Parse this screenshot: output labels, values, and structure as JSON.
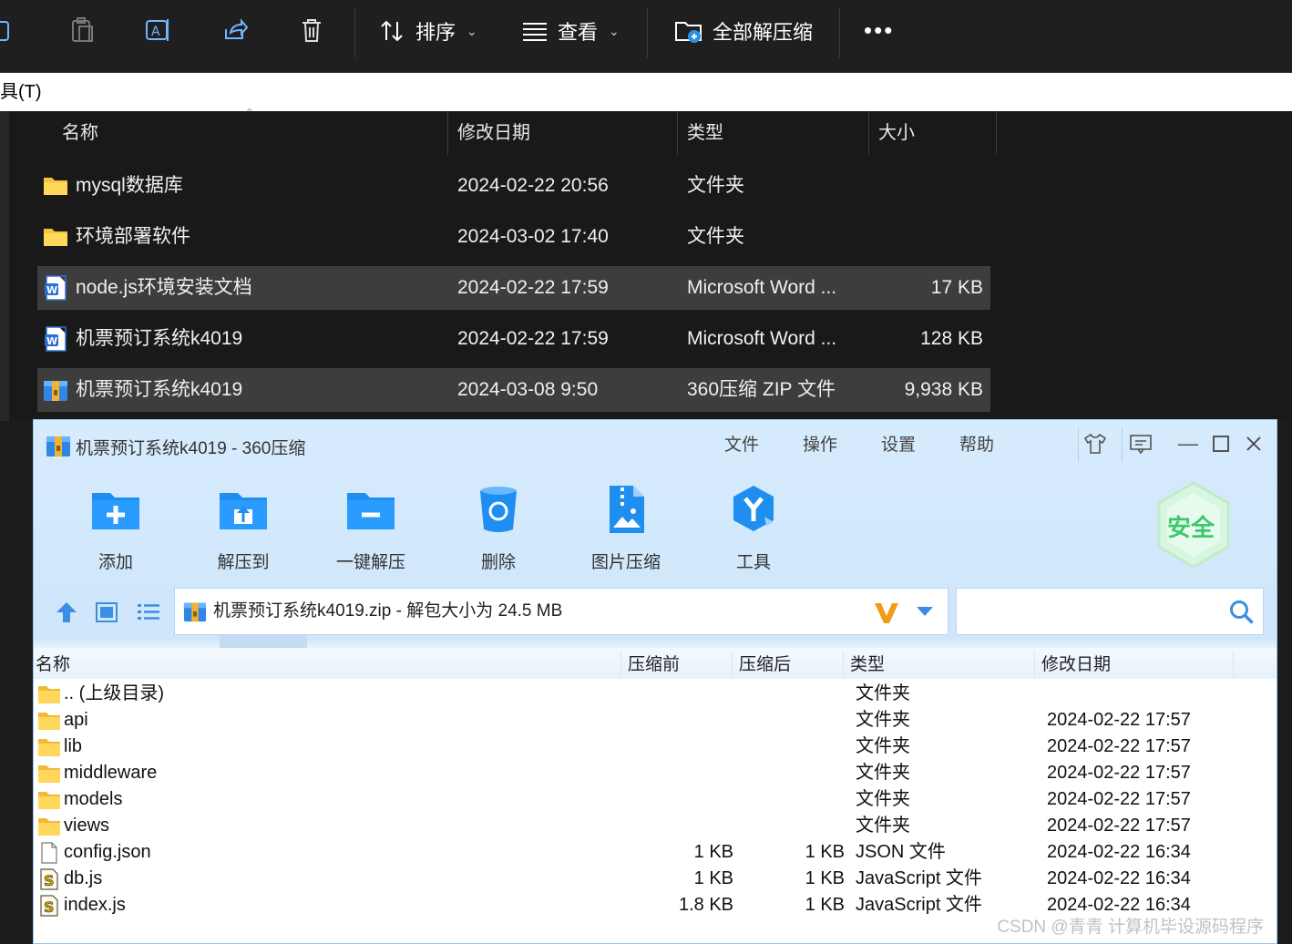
{
  "toolbar": {
    "sort_label": "排序",
    "view_label": "查看",
    "extract_all_label": "全部解压缩",
    "more_label": "•••"
  },
  "menu_strip": {
    "text": "具(T)"
  },
  "explorer": {
    "headers": {
      "name": "名称",
      "modified": "修改日期",
      "type": "类型",
      "size": "大小"
    },
    "rows": [
      {
        "name": "mysql数据库",
        "modified": "2024-02-22 20:56",
        "type": "文件夹",
        "size": "",
        "icon": "folder-icon",
        "selected": false
      },
      {
        "name": "环境部署软件",
        "modified": "2024-03-02 17:40",
        "type": "文件夹",
        "size": "",
        "icon": "folder-icon",
        "selected": false
      },
      {
        "name": "node.js环境安装文档",
        "modified": "2024-02-22 17:59",
        "type": "Microsoft Word ...",
        "size": "17 KB",
        "icon": "word-doc-icon",
        "selected": true
      },
      {
        "name": "机票预订系统k4019",
        "modified": "2024-02-22 17:59",
        "type": "Microsoft Word ...",
        "size": "128 KB",
        "icon": "word-doc-icon",
        "selected": false
      },
      {
        "name": "机票预订系统k4019",
        "modified": "2024-03-08 9:50",
        "type": "360压缩 ZIP 文件",
        "size": "9,938 KB",
        "icon": "zip-archive-icon",
        "selected": true
      }
    ]
  },
  "zip_window": {
    "title": "机票预订系统k4019 - 360压缩",
    "menu": {
      "file": "文件",
      "operate": "操作",
      "settings": "设置",
      "help": "帮助"
    },
    "tools": {
      "add": "添加",
      "extract_to": "解压到",
      "one_click": "一键解压",
      "delete": "删除",
      "image_compress": "图片压缩",
      "tools": "工具"
    },
    "safe_badge": "安全",
    "address": "机票预订系统k4019.zip - 解包大小为 24.5 MB",
    "search_placeholder": "",
    "headers": {
      "name": "名称",
      "before": "压缩前",
      "after": "压缩后",
      "type": "类型",
      "modified": "修改日期"
    },
    "rows": [
      {
        "name": ".. (上级目录)",
        "before": "",
        "after": "",
        "type": "文件夹",
        "modified": "",
        "icon": "folder-icon"
      },
      {
        "name": "api",
        "before": "",
        "after": "",
        "type": "文件夹",
        "modified": "2024-02-22 17:57",
        "icon": "folder-icon"
      },
      {
        "name": "lib",
        "before": "",
        "after": "",
        "type": "文件夹",
        "modified": "2024-02-22 17:57",
        "icon": "folder-icon"
      },
      {
        "name": "middleware",
        "before": "",
        "after": "",
        "type": "文件夹",
        "modified": "2024-02-22 17:57",
        "icon": "folder-icon"
      },
      {
        "name": "models",
        "before": "",
        "after": "",
        "type": "文件夹",
        "modified": "2024-02-22 17:57",
        "icon": "folder-icon"
      },
      {
        "name": "views",
        "before": "",
        "after": "",
        "type": "文件夹",
        "modified": "2024-02-22 17:57",
        "icon": "folder-icon"
      },
      {
        "name": "config.json",
        "before": "1 KB",
        "after": "1 KB",
        "type": "JSON 文件",
        "modified": "2024-02-22 16:34",
        "icon": "file-icon"
      },
      {
        "name": "db.js",
        "before": "1 KB",
        "after": "1 KB",
        "type": "JavaScript 文件",
        "modified": "2024-02-22 16:34",
        "icon": "script-file-icon"
      },
      {
        "name": "index.js",
        "before": "1.8 KB",
        "after": "1 KB",
        "type": "JavaScript 文件",
        "modified": "2024-02-22 16:34",
        "icon": "script-file-icon"
      }
    ]
  },
  "watermark": "CSDN @青青  计算机毕设源码程序",
  "colors": {
    "explorer_bg": "#191919",
    "selected_row": "#3d3d3d",
    "zip_accent": "#1e90ff",
    "folder_yellow": "#f5c338"
  }
}
